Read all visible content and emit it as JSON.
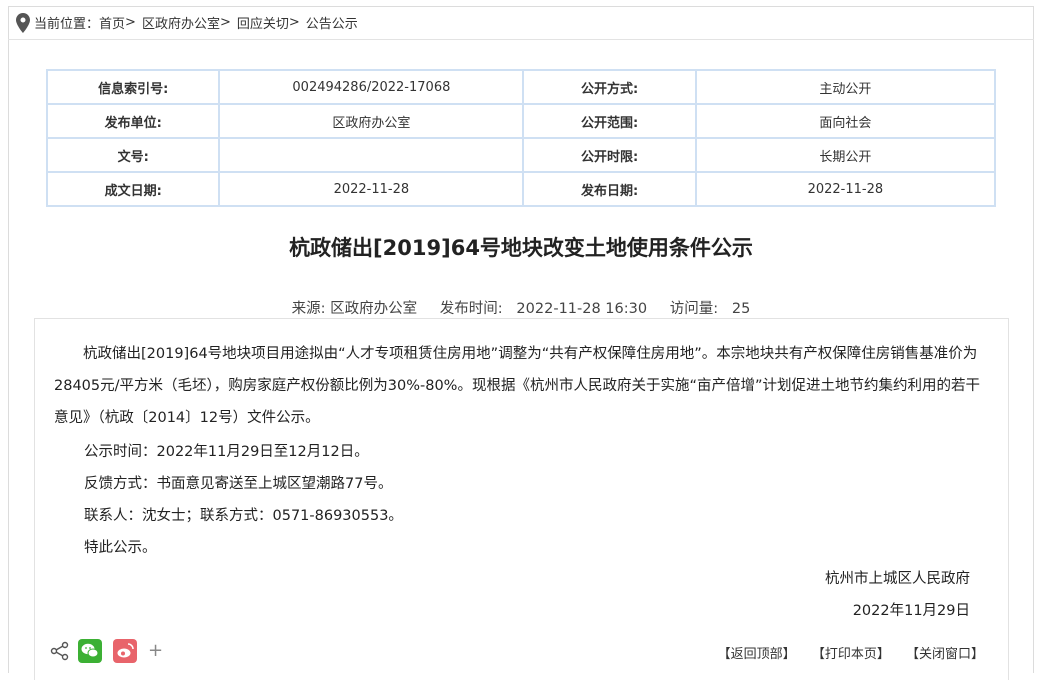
{
  "breadcrumb": {
    "prefix": "当前位置：",
    "items": [
      "首页",
      "区政府办公室",
      "回应关切",
      "公告公示"
    ],
    "sep": ">"
  },
  "info_table": {
    "rows": [
      {
        "l1": "信息索引号:",
        "v1": "002494286/2022-17068",
        "l2": "公开方式:",
        "v2": "主动公开"
      },
      {
        "l1": "发布单位:",
        "v1": "区政府办公室",
        "l2": "公开范围:",
        "v2": "面向社会"
      },
      {
        "l1": "文号:",
        "v1": "",
        "l2": "公开时限:",
        "v2": "长期公开"
      },
      {
        "l1": "成文日期:",
        "v1": "2022-11-28",
        "l2": "发布日期:",
        "v2": "2022-11-28"
      }
    ]
  },
  "article": {
    "title": "杭政储出[2019]64号地块改变土地使用条件公示",
    "meta": {
      "source": "来源: 区政府办公室",
      "publish_time": "发布时间:   2022-11-28 16:30",
      "views": "访问量:   25"
    },
    "para1": "杭政储出[2019]64号地块项目用途拟由“人才专项租赁住房用地”调整为“共有产权保障住房用地”。本宗地块共有产权保障住房销售基准价为28405元/平方米（毛坯），购房家庭产权份额比例为30%-80%。现根据《杭州市人民政府关于实施“亩产倍增”计划促进土地节约集约利用的若干意见》（杭政〔2014〕12号）文件公示。",
    "notice_time": "公示时间：2022年11月29日至12月12日。",
    "feedback": "反馈方式：书面意见寄送至上城区望潮路77号。",
    "contact": "联系人：沈女士；联系方式：0571-86930553。",
    "closing": "特此公示。",
    "signature": "杭州市上城区人民政府",
    "sign_date": "2022年11月29日"
  },
  "footer": {
    "plus": "+",
    "back_top": "【返回顶部】",
    "print": "【打印本页】",
    "close": "【关闭窗口】"
  },
  "colors": {
    "table_border": "#cfe0f3",
    "wechat": "#3cb034",
    "weibo": "#e8646b"
  }
}
